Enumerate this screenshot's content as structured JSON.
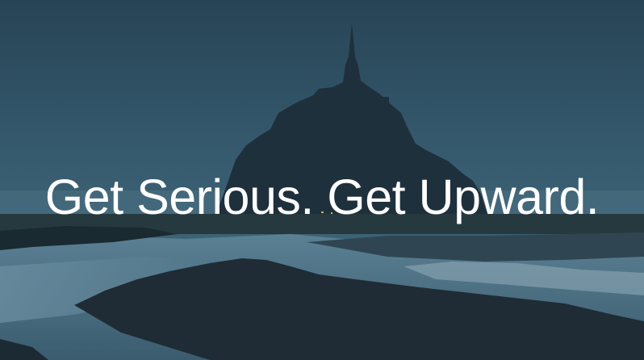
{
  "hero": {
    "headline": "Get Serious. Get Upward."
  },
  "colors": {
    "sky_top": "#284657",
    "sky_mid": "#35576a",
    "sky_horizon": "#3d6376",
    "silhouette": "#1f2f3c",
    "water": "#4f7487",
    "land_dark": "#1c2a33",
    "headline": "#ffffff"
  }
}
